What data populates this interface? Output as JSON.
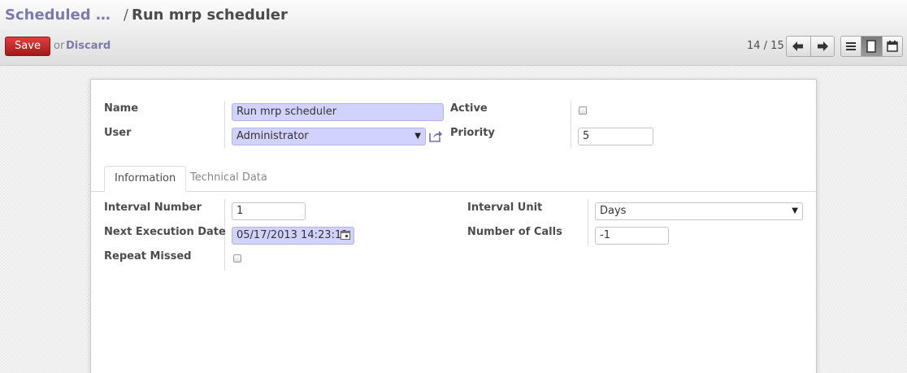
{
  "breadcrumb": {
    "parent": "Scheduled …",
    "separator": "/",
    "current": "Run mrp scheduler"
  },
  "toolbar": {
    "save_label": "Save",
    "or_text": "or",
    "discard_label": "Discard"
  },
  "pager": {
    "text": "14 / 15"
  },
  "icons": {
    "prev": "arrow-left-icon",
    "next": "arrow-right-icon",
    "list_view": "list-view-icon",
    "form_view": "form-view-icon",
    "calendar_view": "calendar-view-icon",
    "external_link": "external-link-icon",
    "date_picker": "calendar-icon"
  },
  "form": {
    "name_label": "Name",
    "name_value": "Run mrp scheduler",
    "user_label": "User",
    "user_value": "Administrator",
    "active_label": "Active",
    "active_checked": false,
    "priority_label": "Priority",
    "priority_value": "5"
  },
  "tabs": [
    {
      "label": "Information",
      "active": true
    },
    {
      "label": "Technical Data",
      "active": false
    }
  ],
  "information": {
    "interval_number_label": "Interval Number",
    "interval_number_value": "1",
    "next_execution_label": "Next Execution Date",
    "next_execution_value": "05/17/2013 14:23:11",
    "repeat_missed_label": "Repeat Missed",
    "repeat_missed_checked": false,
    "interval_unit_label": "Interval Unit",
    "interval_unit_value": "Days",
    "number_of_calls_label": "Number of Calls",
    "number_of_calls_value": "-1"
  },
  "colors": {
    "required_field": "#d2d2ff",
    "link": "#7c7bad",
    "save_button": "#c02525"
  }
}
